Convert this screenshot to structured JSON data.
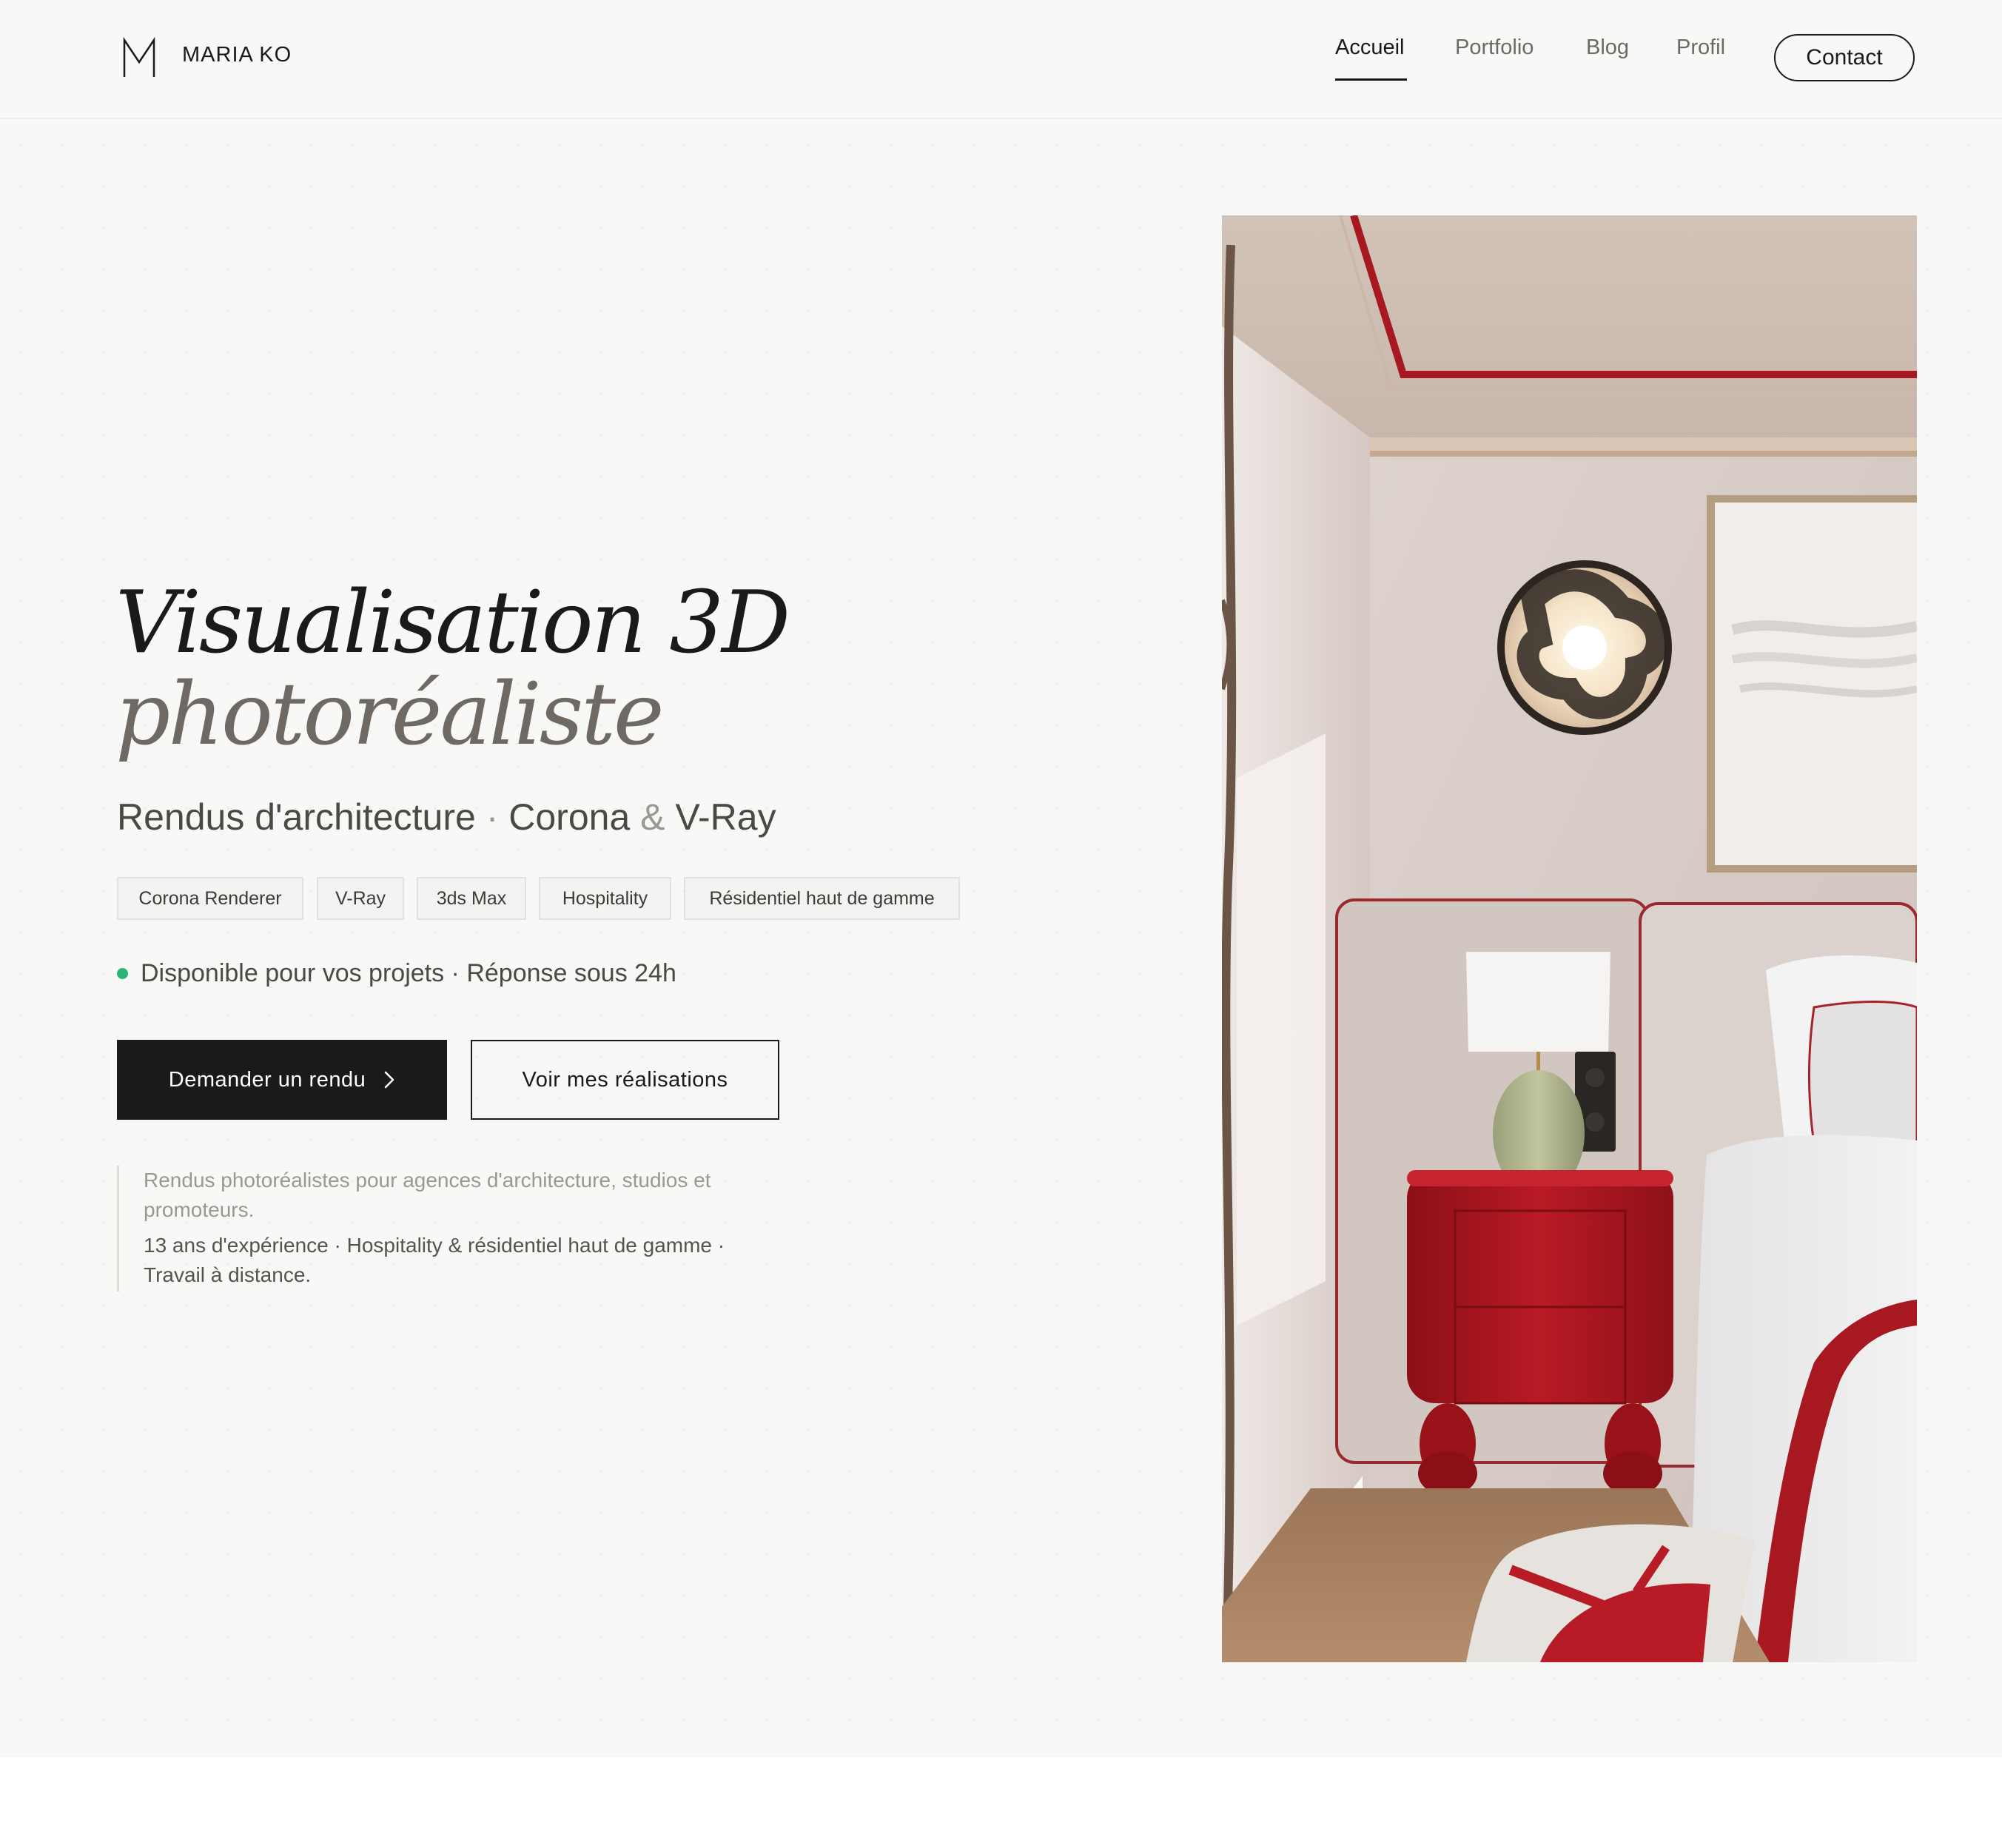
{
  "brand": {
    "name": "MARIA KO"
  },
  "nav": {
    "items": [
      "Accueil",
      "Portfolio",
      "Blog",
      "Profil"
    ],
    "active": "Accueil",
    "contact_label": "Contact"
  },
  "hero": {
    "title_line1": "Visualisation  3D",
    "title_line2": "photoréaliste",
    "subtitle_a": "Rendus d'architecture",
    "subtitle_sep1": " · ",
    "subtitle_b": "Corona",
    "subtitle_amp": " & ",
    "subtitle_c": "V-Ray",
    "tags": [
      "Corona Renderer",
      "V-Ray",
      "3ds Max",
      "Hospitality",
      "Résidentiel haut de gamme"
    ],
    "availability": "Disponible pour vos projets · Réponse sous 24h",
    "primary_cta": "Demander un rendu",
    "secondary_cta": "Voir mes réalisations",
    "quote_line1": "Rendus photoréalistes pour agences d'architecture, studios et promoteurs.",
    "quote_line2": "13 ans d'expérience · Hospitality & résidentiel haut de gamme · Travail à distance."
  },
  "colors": {
    "ink": "#1b1a18",
    "accent_muted": "#6f6963",
    "status_green": "#2bb673",
    "bedroom_red": "#a8141e"
  },
  "icons": {
    "logo": "logo-m-icon",
    "primary_cta": "chevron-right-icon",
    "status": "status-dot-icon"
  }
}
